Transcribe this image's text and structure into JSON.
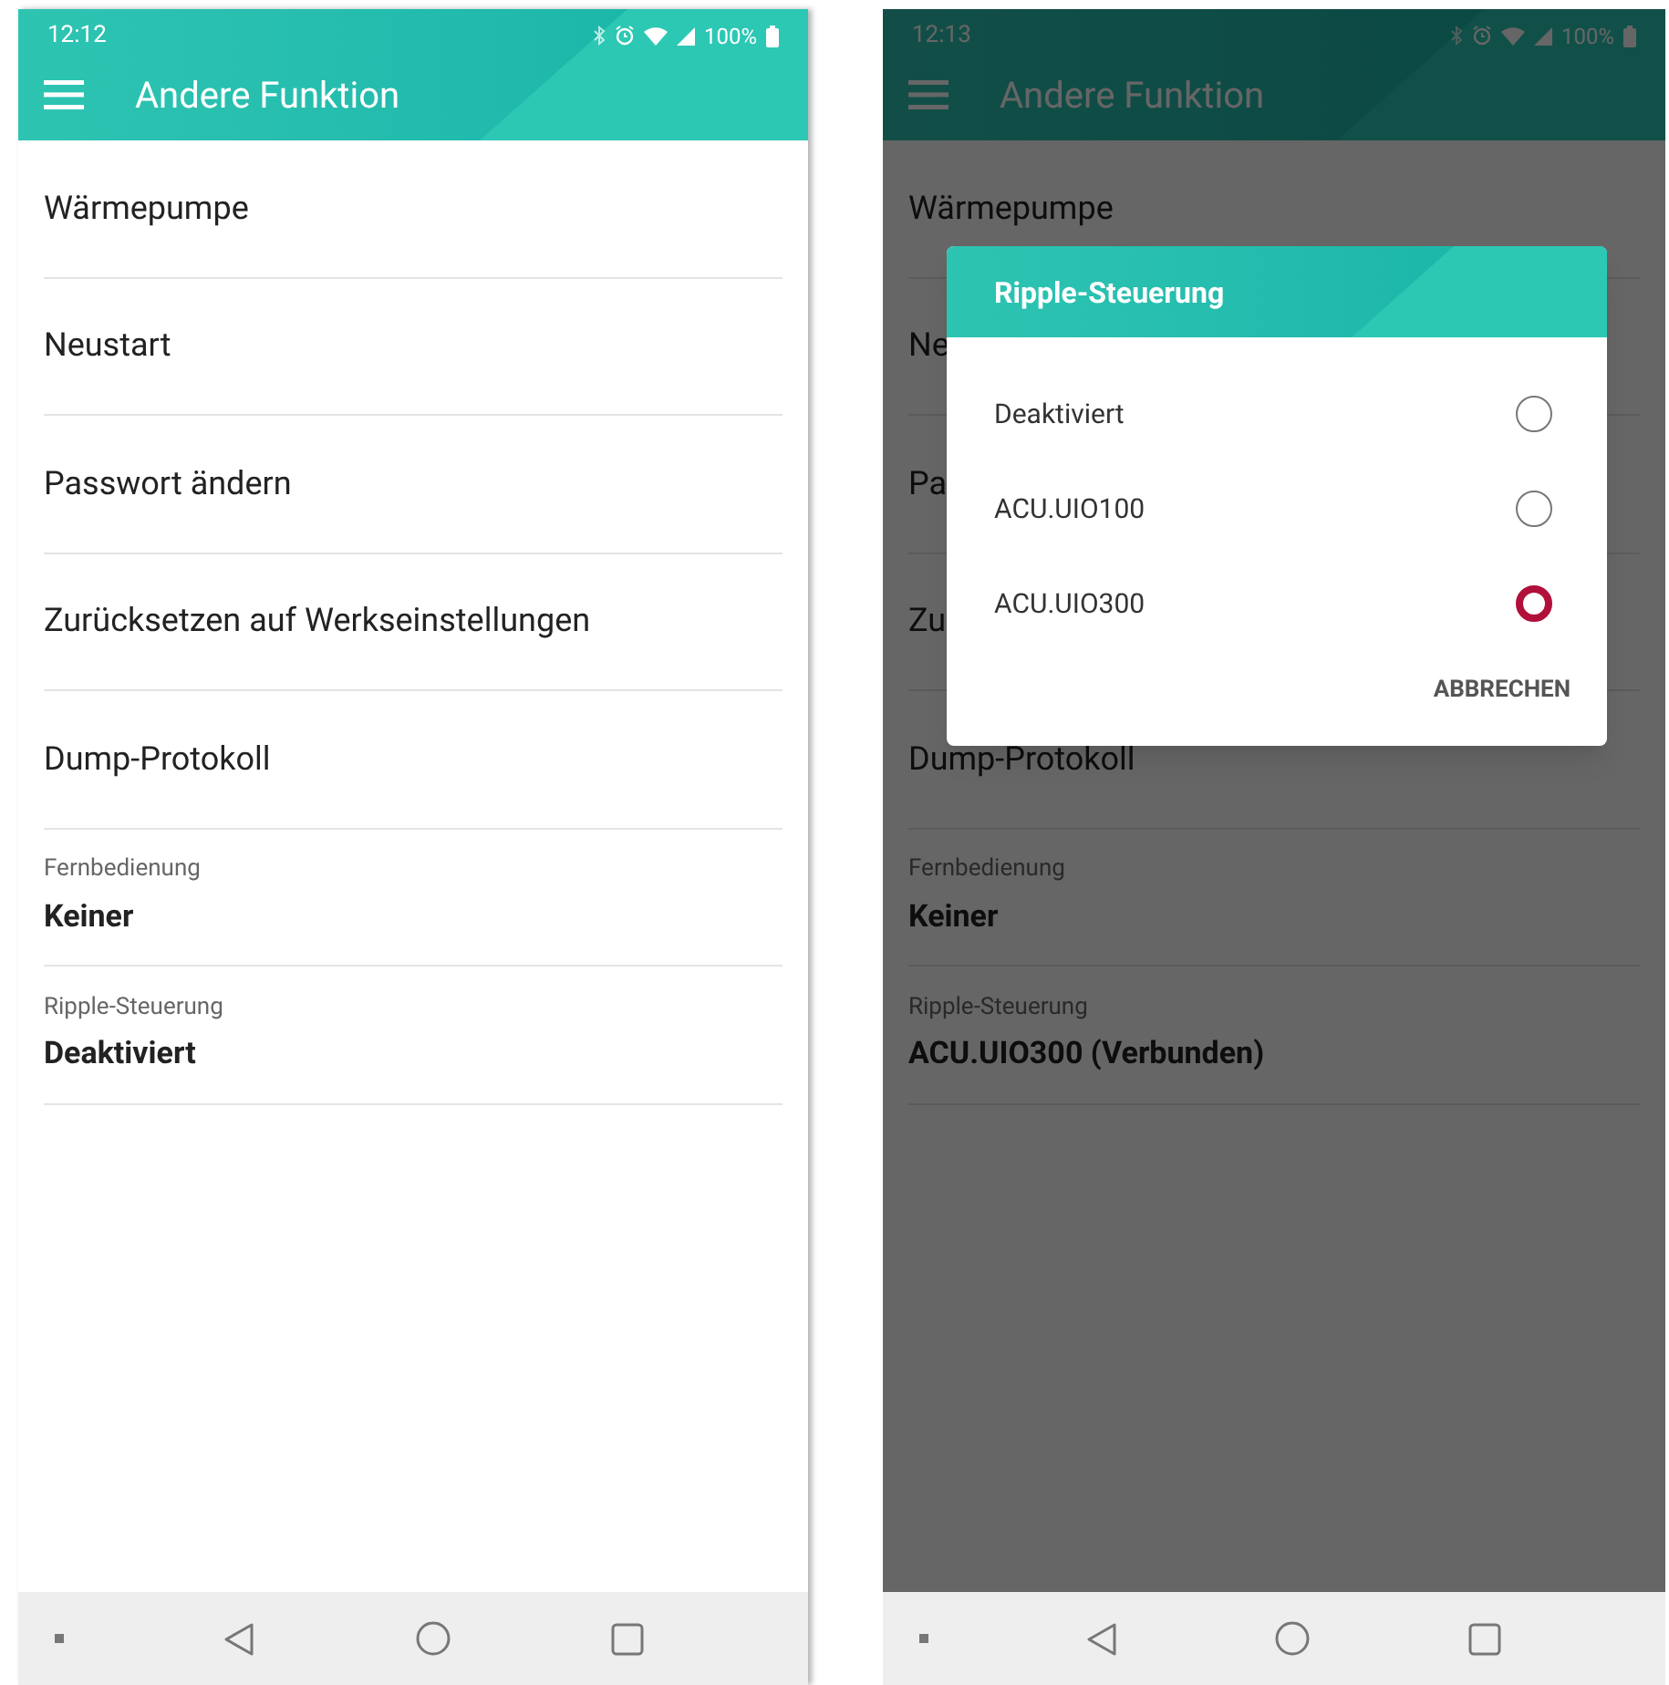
{
  "phones": [
    {
      "status_bar": {
        "time": "12:12",
        "battery": "100%"
      },
      "app_bar": {
        "title": "Andere Funktion"
      },
      "dimmed": false,
      "items": [
        {
          "kind": "single",
          "label": "Wärmepumpe"
        },
        {
          "kind": "single",
          "label": "Neustart"
        },
        {
          "kind": "single",
          "label": "Passwort ändern"
        },
        {
          "kind": "single",
          "label": "Zurücksetzen auf Werkseinstellungen"
        },
        {
          "kind": "single",
          "label": "Dump-Protokoll"
        },
        {
          "kind": "setting",
          "label": "Fernbedienung",
          "value": "Keiner"
        },
        {
          "kind": "setting",
          "label": "Ripple-Steuerung",
          "value": "Deaktiviert"
        }
      ]
    },
    {
      "status_bar": {
        "time": "12:13",
        "battery": "100%"
      },
      "app_bar": {
        "title": "Andere Funktion"
      },
      "dimmed": true,
      "items": [
        {
          "kind": "single",
          "label": "Wärmepumpe"
        },
        {
          "kind": "single",
          "label": "Ne"
        },
        {
          "kind": "single",
          "label": "Pa"
        },
        {
          "kind": "single",
          "label": "Zu"
        },
        {
          "kind": "single",
          "label": "Dump-Protokoll"
        },
        {
          "kind": "setting",
          "label": "Fernbedienung",
          "value": "Keiner"
        },
        {
          "kind": "setting",
          "label": "Ripple-Steuerung",
          "value": "ACU.UIO300 (Verbunden)"
        }
      ],
      "dialog": {
        "title": "Ripple-Steuerung",
        "options": [
          {
            "label": "Deaktiviert",
            "selected": false
          },
          {
            "label": "ACU.UIO100",
            "selected": false
          },
          {
            "label": "ACU.UIO300",
            "selected": true
          }
        ],
        "cancel": "ABBRECHEN"
      }
    }
  ]
}
